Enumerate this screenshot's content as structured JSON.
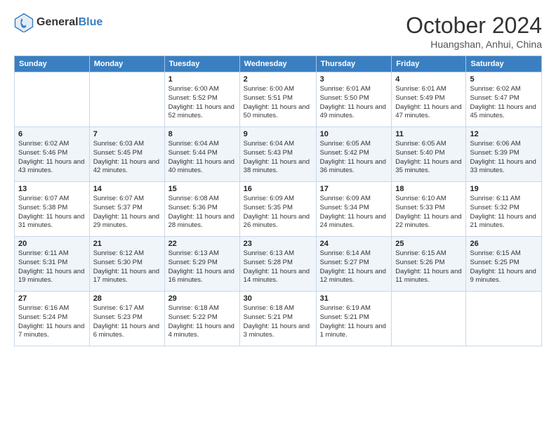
{
  "header": {
    "logo_line1": "General",
    "logo_line2": "Blue",
    "month": "October 2024",
    "location": "Huangshan, Anhui, China"
  },
  "days_of_week": [
    "Sunday",
    "Monday",
    "Tuesday",
    "Wednesday",
    "Thursday",
    "Friday",
    "Saturday"
  ],
  "weeks": [
    [
      {
        "num": "",
        "info": ""
      },
      {
        "num": "",
        "info": ""
      },
      {
        "num": "1",
        "info": "Sunrise: 6:00 AM\nSunset: 5:52 PM\nDaylight: 11 hours and 52 minutes."
      },
      {
        "num": "2",
        "info": "Sunrise: 6:00 AM\nSunset: 5:51 PM\nDaylight: 11 hours and 50 minutes."
      },
      {
        "num": "3",
        "info": "Sunrise: 6:01 AM\nSunset: 5:50 PM\nDaylight: 11 hours and 49 minutes."
      },
      {
        "num": "4",
        "info": "Sunrise: 6:01 AM\nSunset: 5:49 PM\nDaylight: 11 hours and 47 minutes."
      },
      {
        "num": "5",
        "info": "Sunrise: 6:02 AM\nSunset: 5:47 PM\nDaylight: 11 hours and 45 minutes."
      }
    ],
    [
      {
        "num": "6",
        "info": "Sunrise: 6:02 AM\nSunset: 5:46 PM\nDaylight: 11 hours and 43 minutes."
      },
      {
        "num": "7",
        "info": "Sunrise: 6:03 AM\nSunset: 5:45 PM\nDaylight: 11 hours and 42 minutes."
      },
      {
        "num": "8",
        "info": "Sunrise: 6:04 AM\nSunset: 5:44 PM\nDaylight: 11 hours and 40 minutes."
      },
      {
        "num": "9",
        "info": "Sunrise: 6:04 AM\nSunset: 5:43 PM\nDaylight: 11 hours and 38 minutes."
      },
      {
        "num": "10",
        "info": "Sunrise: 6:05 AM\nSunset: 5:42 PM\nDaylight: 11 hours and 36 minutes."
      },
      {
        "num": "11",
        "info": "Sunrise: 6:05 AM\nSunset: 5:40 PM\nDaylight: 11 hours and 35 minutes."
      },
      {
        "num": "12",
        "info": "Sunrise: 6:06 AM\nSunset: 5:39 PM\nDaylight: 11 hours and 33 minutes."
      }
    ],
    [
      {
        "num": "13",
        "info": "Sunrise: 6:07 AM\nSunset: 5:38 PM\nDaylight: 11 hours and 31 minutes."
      },
      {
        "num": "14",
        "info": "Sunrise: 6:07 AM\nSunset: 5:37 PM\nDaylight: 11 hours and 29 minutes."
      },
      {
        "num": "15",
        "info": "Sunrise: 6:08 AM\nSunset: 5:36 PM\nDaylight: 11 hours and 28 minutes."
      },
      {
        "num": "16",
        "info": "Sunrise: 6:09 AM\nSunset: 5:35 PM\nDaylight: 11 hours and 26 minutes."
      },
      {
        "num": "17",
        "info": "Sunrise: 6:09 AM\nSunset: 5:34 PM\nDaylight: 11 hours and 24 minutes."
      },
      {
        "num": "18",
        "info": "Sunrise: 6:10 AM\nSunset: 5:33 PM\nDaylight: 11 hours and 22 minutes."
      },
      {
        "num": "19",
        "info": "Sunrise: 6:11 AM\nSunset: 5:32 PM\nDaylight: 11 hours and 21 minutes."
      }
    ],
    [
      {
        "num": "20",
        "info": "Sunrise: 6:11 AM\nSunset: 5:31 PM\nDaylight: 11 hours and 19 minutes."
      },
      {
        "num": "21",
        "info": "Sunrise: 6:12 AM\nSunset: 5:30 PM\nDaylight: 11 hours and 17 minutes."
      },
      {
        "num": "22",
        "info": "Sunrise: 6:13 AM\nSunset: 5:29 PM\nDaylight: 11 hours and 16 minutes."
      },
      {
        "num": "23",
        "info": "Sunrise: 6:13 AM\nSunset: 5:28 PM\nDaylight: 11 hours and 14 minutes."
      },
      {
        "num": "24",
        "info": "Sunrise: 6:14 AM\nSunset: 5:27 PM\nDaylight: 11 hours and 12 minutes."
      },
      {
        "num": "25",
        "info": "Sunrise: 6:15 AM\nSunset: 5:26 PM\nDaylight: 11 hours and 11 minutes."
      },
      {
        "num": "26",
        "info": "Sunrise: 6:15 AM\nSunset: 5:25 PM\nDaylight: 11 hours and 9 minutes."
      }
    ],
    [
      {
        "num": "27",
        "info": "Sunrise: 6:16 AM\nSunset: 5:24 PM\nDaylight: 11 hours and 7 minutes."
      },
      {
        "num": "28",
        "info": "Sunrise: 6:17 AM\nSunset: 5:23 PM\nDaylight: 11 hours and 6 minutes."
      },
      {
        "num": "29",
        "info": "Sunrise: 6:18 AM\nSunset: 5:22 PM\nDaylight: 11 hours and 4 minutes."
      },
      {
        "num": "30",
        "info": "Sunrise: 6:18 AM\nSunset: 5:21 PM\nDaylight: 11 hours and 3 minutes."
      },
      {
        "num": "31",
        "info": "Sunrise: 6:19 AM\nSunset: 5:21 PM\nDaylight: 11 hours and 1 minute."
      },
      {
        "num": "",
        "info": ""
      },
      {
        "num": "",
        "info": ""
      }
    ]
  ]
}
